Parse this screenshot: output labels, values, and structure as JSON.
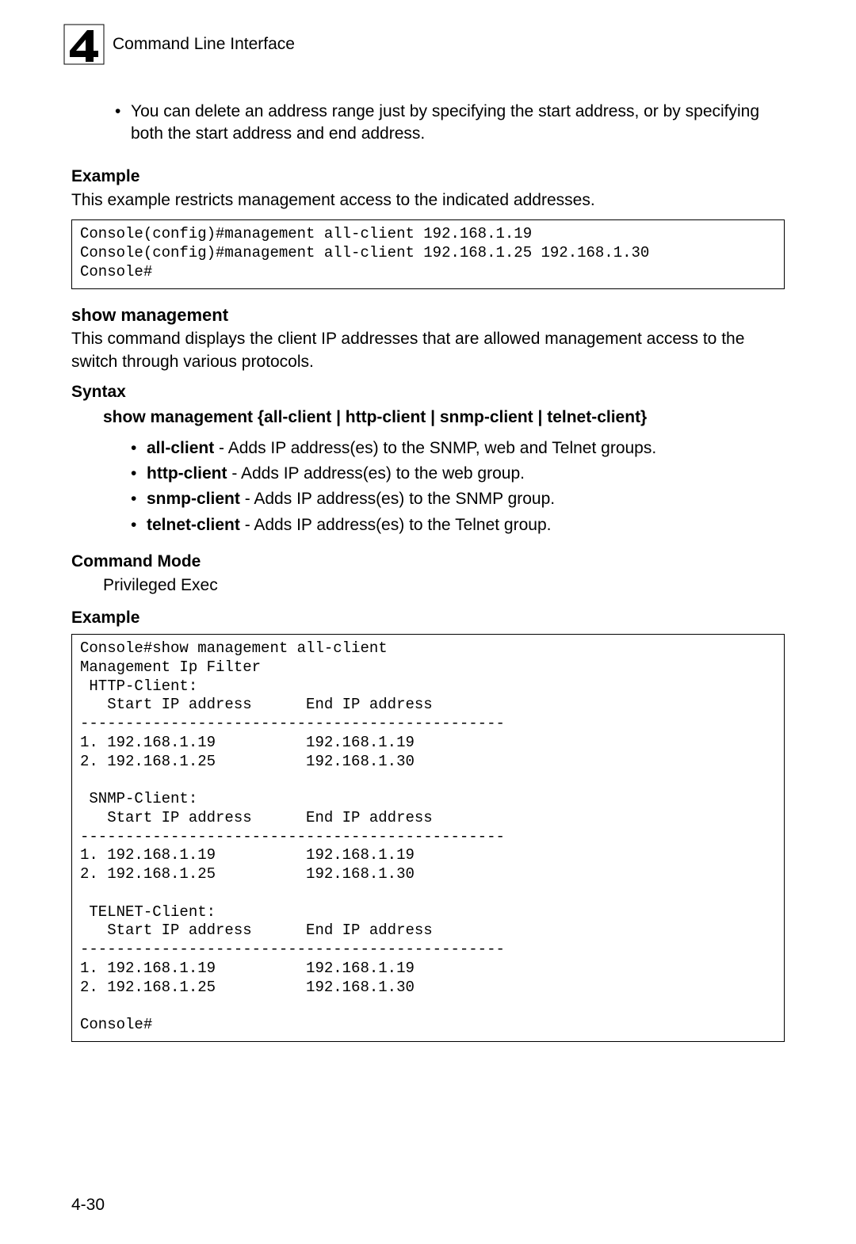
{
  "header": {
    "chapter_number": "4",
    "title": "Command Line Interface"
  },
  "intro_bullet": "You can delete an address range just by specifying the start address, or by specifying both the start address and end address.",
  "example1": {
    "heading": "Example",
    "desc": "This example restricts management access to the indicated addresses.",
    "code": "Console(config)#management all-client 192.168.1.19\nConsole(config)#management all-client 192.168.1.25 192.168.1.30\nConsole#"
  },
  "show_mgmt": {
    "heading": "show management",
    "desc": "This command displays the client IP addresses that are allowed management access to the switch through various protocols."
  },
  "syntax": {
    "heading": "Syntax",
    "line_prefix": "show management",
    "line_suffix": " {all-client | http-client | snmp-client | telnet-client}",
    "items": [
      {
        "term": "all-client",
        "desc": " - Adds IP address(es) to the SNMP, web and Telnet groups."
      },
      {
        "term": "http-client",
        "desc": " - Adds IP address(es) to the web group."
      },
      {
        "term": "snmp-client",
        "desc": " - Adds IP address(es) to the SNMP group."
      },
      {
        "term": "telnet-client",
        "desc": " - Adds IP address(es) to the Telnet group."
      }
    ]
  },
  "command_mode": {
    "heading": "Command Mode",
    "value": "Privileged Exec"
  },
  "example2": {
    "heading": "Example",
    "code": "Console#show management all-client\nManagement Ip Filter\n HTTP-Client:\n   Start IP address      End IP address\n-----------------------------------------------\n1. 192.168.1.19          192.168.1.19\n2. 192.168.1.25          192.168.1.30\n\n SNMP-Client:\n   Start IP address      End IP address\n-----------------------------------------------\n1. 192.168.1.19          192.168.1.19\n2. 192.168.1.25          192.168.1.30\n\n TELNET-Client:\n   Start IP address      End IP address\n-----------------------------------------------\n1. 192.168.1.19          192.168.1.19\n2. 192.168.1.25          192.168.1.30\n\nConsole#"
  },
  "page_number": "4-30"
}
